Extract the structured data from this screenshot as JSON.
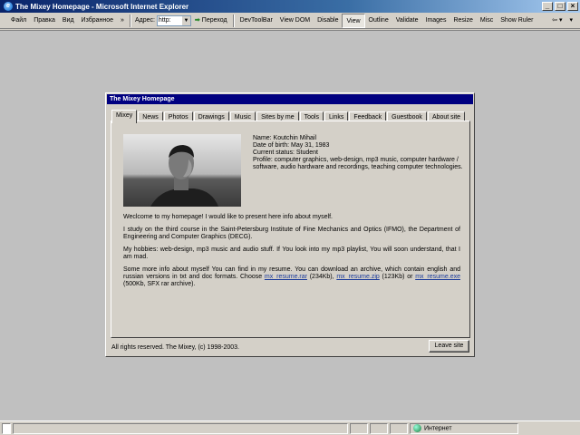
{
  "window": {
    "title": "The Mixey Homepage - Microsoft Internet Explorer"
  },
  "toolbar": {
    "menu": [
      "Файл",
      "Правка",
      "Вид",
      "Избранное"
    ],
    "more": "»",
    "address_label": "Адрес:",
    "address_value": "http:",
    "go_label": "Переход",
    "tools": [
      "DevToolBar",
      "View DOM",
      "Disable",
      "View",
      "Outline",
      "Validate",
      "Images",
      "Resize",
      "Misc",
      "Show Ruler"
    ]
  },
  "page": {
    "title": "The Mixey Homepage",
    "tabs": [
      "Mixey",
      "News",
      "Photos",
      "Drawings",
      "Music",
      "Sites by me",
      "Tools",
      "Links",
      "Feedback",
      "Guestbook",
      "About site"
    ],
    "info": {
      "name": "Name: Koutchin Mihail",
      "dob": "Date of birth: May 31, 1983",
      "status": "Current status: Student",
      "profile": "Profile: computer graphics, web-design, mp3 music, computer hardware / software, audio hardware and recordings, teaching computer technologies."
    },
    "paragraphs": {
      "p1": "Weclcome to my homepage! I would like to present here info about myself.",
      "p2": "I study on the third course in the Saint-Petersburg Institute of Fine Mechanics and Optics (IFMO), the Department of Engineering and Computer Graphics (DECG).",
      "p3": "My hobbies: web-design, mp3 music and audio stuff. If You look into my mp3 playlist, You will soon understand, that I am mad.",
      "p4_start": "Some more info about myself You can find in my resume. You can download an archive, which contain english and russian versions in txt and doc formats. Choose ",
      "link_rar": "mx_resume.rar",
      "size_rar": " (234Kb), ",
      "link_zip": "mx_resume.zip",
      "size_zip": " (123Kb) or ",
      "link_exe": "mx_resume.exe",
      "size_exe": " (500Kb, SFX rar archive)."
    },
    "footer": "All rights reserved. The Mixey, (c) 1998-2003.",
    "leave_button": "Leave site"
  },
  "statusbar": {
    "zone": "Интернет"
  }
}
